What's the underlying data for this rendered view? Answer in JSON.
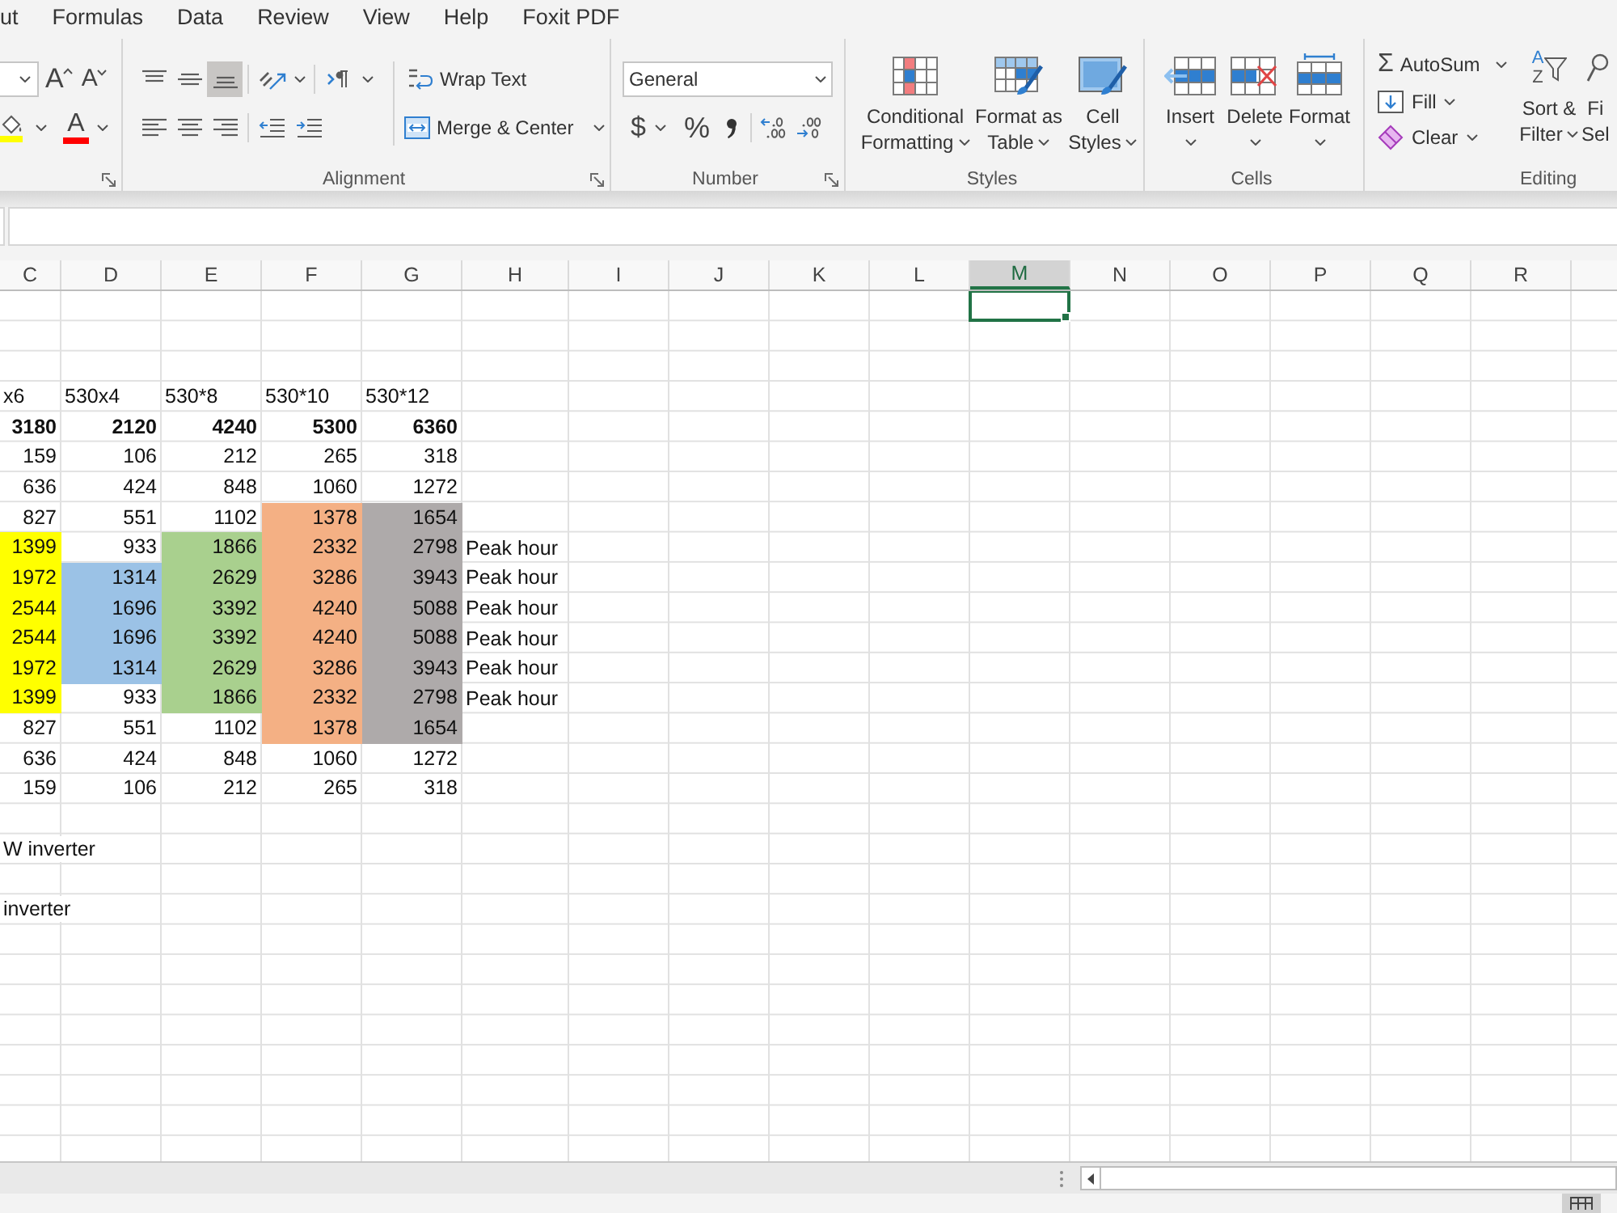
{
  "menu_tabs": [
    {
      "label": "ut",
      "selected": false
    },
    {
      "label": "Formulas",
      "selected": false
    },
    {
      "label": "Data",
      "selected": false
    },
    {
      "label": "Review",
      "selected": false
    },
    {
      "label": "View",
      "selected": false
    },
    {
      "label": "Help",
      "selected": false
    },
    {
      "label": "Foxit PDF",
      "selected": false
    }
  ],
  "ribbon": {
    "font": {
      "grow_glyph": "A",
      "shrink_glyph": "A",
      "font_color_glyph": "A"
    },
    "alignment": {
      "label": "Alignment",
      "vertical": [
        {
          "kind": "top",
          "selected": false
        },
        {
          "kind": "middle",
          "selected": false
        },
        {
          "kind": "bottom",
          "selected": true
        }
      ],
      "horizontal": [
        {
          "kind": "left",
          "selected": false
        },
        {
          "kind": "center",
          "selected": false
        },
        {
          "kind": "right",
          "selected": false
        }
      ],
      "wrap_text": "Wrap Text",
      "merge": "Merge & Center"
    },
    "number": {
      "label": "Number",
      "format": "General",
      "currency": "$",
      "percent": "%"
    },
    "styles": {
      "label": "Styles",
      "buttons": [
        {
          "kind": "conditional",
          "lines": [
            "Conditional",
            "Formatting"
          ]
        },
        {
          "kind": "table",
          "lines": [
            "Format as",
            "Table"
          ]
        },
        {
          "kind": "cell",
          "lines": [
            "Cell",
            "Styles"
          ]
        }
      ]
    },
    "cells": {
      "label": "Cells",
      "buttons": [
        {
          "kind": "insert",
          "label": "Insert"
        },
        {
          "kind": "delete",
          "label": "Delete"
        },
        {
          "kind": "format",
          "label": "Format"
        }
      ]
    },
    "editing": {
      "label": "Editing",
      "sum_glyph": "Σ",
      "autosum": "AutoSum",
      "fill": "Fill",
      "clear": "Clear",
      "sort_glyphs": [
        "A",
        "Z"
      ],
      "sort_lines": [
        "Sort &",
        "Filter"
      ],
      "find_lines": [
        "Fi",
        "Sel"
      ]
    }
  },
  "sheet": {
    "columns": [
      {
        "label": "C",
        "selected": false
      },
      {
        "label": "D",
        "selected": false
      },
      {
        "label": "E",
        "selected": false
      },
      {
        "label": "F",
        "selected": false
      },
      {
        "label": "G",
        "selected": false
      },
      {
        "label": "H",
        "selected": false
      },
      {
        "label": "I",
        "selected": false
      },
      {
        "label": "J",
        "selected": false
      },
      {
        "label": "K",
        "selected": false
      },
      {
        "label": "L",
        "selected": false
      },
      {
        "label": "M",
        "selected": true
      },
      {
        "label": "N",
        "selected": false
      },
      {
        "label": "O",
        "selected": false
      },
      {
        "label": "P",
        "selected": false
      },
      {
        "label": "Q",
        "selected": false
      },
      {
        "label": "R",
        "selected": false
      }
    ],
    "rows": [
      {
        "selected": true
      },
      {
        "selected": false
      },
      {
        "selected": false
      },
      {
        "selected": false,
        "bold": false,
        "cells": [
          {
            "text": "x6",
            "kind": "text"
          },
          {
            "text": "530x4",
            "kind": "text"
          },
          {
            "text": "530*8",
            "kind": "text"
          },
          {
            "text": "530*10",
            "kind": "text"
          },
          {
            "text": "530*12",
            "kind": "text"
          }
        ]
      },
      {
        "selected": false,
        "bold": true,
        "cells": [
          {
            "text": "3180",
            "kind": "number"
          },
          {
            "text": "2120",
            "kind": "number"
          },
          {
            "text": "4240",
            "kind": "number"
          },
          {
            "text": "5300",
            "kind": "number"
          },
          {
            "text": "6360",
            "kind": "number"
          }
        ]
      },
      {
        "selected": false,
        "bold": false,
        "cells": [
          {
            "text": "159",
            "kind": "number"
          },
          {
            "text": "106",
            "kind": "number"
          },
          {
            "text": "212",
            "kind": "number"
          },
          {
            "text": "265",
            "kind": "number"
          },
          {
            "text": "318",
            "kind": "number"
          }
        ]
      },
      {
        "selected": false,
        "bold": false,
        "cells": [
          {
            "text": "636",
            "kind": "number"
          },
          {
            "text": "424",
            "kind": "number"
          },
          {
            "text": "848",
            "kind": "number"
          },
          {
            "text": "1060",
            "kind": "number"
          },
          {
            "text": "1272",
            "kind": "number"
          }
        ]
      },
      {
        "selected": false,
        "bold": false,
        "cells": [
          {
            "text": "827",
            "kind": "number"
          },
          {
            "text": "551",
            "kind": "number"
          },
          {
            "text": "1102",
            "kind": "number"
          },
          {
            "text": "1378",
            "kind": "number",
            "color": "#f4b084"
          },
          {
            "text": "1654",
            "kind": "number",
            "color": "#aeaaaa"
          }
        ]
      },
      {
        "selected": false,
        "bold": false,
        "cells": [
          {
            "text": "1399",
            "kind": "number",
            "color": "#ffff00"
          },
          {
            "text": "933",
            "kind": "number"
          },
          {
            "text": "1866",
            "kind": "number",
            "color": "#a9d08e"
          },
          {
            "text": "2332",
            "kind": "number",
            "color": "#f4b084"
          },
          {
            "text": "2798",
            "kind": "number",
            "color": "#aeaaaa"
          },
          {
            "text": "Peak hour",
            "kind": "text"
          }
        ]
      },
      {
        "selected": false,
        "bold": false,
        "cells": [
          {
            "text": "1972",
            "kind": "number",
            "color": "#ffff00"
          },
          {
            "text": "1314",
            "kind": "number",
            "color": "#9bc2e6"
          },
          {
            "text": "2629",
            "kind": "number",
            "color": "#a9d08e"
          },
          {
            "text": "3286",
            "kind": "number",
            "color": "#f4b084"
          },
          {
            "text": "3943",
            "kind": "number",
            "color": "#aeaaaa"
          },
          {
            "text": "Peak hour",
            "kind": "text"
          }
        ]
      },
      {
        "selected": false,
        "bold": false,
        "cells": [
          {
            "text": "2544",
            "kind": "number",
            "color": "#ffff00"
          },
          {
            "text": "1696",
            "kind": "number",
            "color": "#9bc2e6"
          },
          {
            "text": "3392",
            "kind": "number",
            "color": "#a9d08e"
          },
          {
            "text": "4240",
            "kind": "number",
            "color": "#f4b084"
          },
          {
            "text": "5088",
            "kind": "number",
            "color": "#aeaaaa"
          },
          {
            "text": "Peak hour",
            "kind": "text"
          }
        ]
      },
      {
        "selected": false,
        "bold": false,
        "cells": [
          {
            "text": "2544",
            "kind": "number",
            "color": "#ffff00"
          },
          {
            "text": "1696",
            "kind": "number",
            "color": "#9bc2e6"
          },
          {
            "text": "3392",
            "kind": "number",
            "color": "#a9d08e"
          },
          {
            "text": "4240",
            "kind": "number",
            "color": "#f4b084"
          },
          {
            "text": "5088",
            "kind": "number",
            "color": "#aeaaaa"
          },
          {
            "text": "Peak hour",
            "kind": "text"
          }
        ]
      },
      {
        "selected": false,
        "bold": false,
        "cells": [
          {
            "text": "1972",
            "kind": "number",
            "color": "#ffff00"
          },
          {
            "text": "1314",
            "kind": "number",
            "color": "#9bc2e6"
          },
          {
            "text": "2629",
            "kind": "number",
            "color": "#a9d08e"
          },
          {
            "text": "3286",
            "kind": "number",
            "color": "#f4b084"
          },
          {
            "text": "3943",
            "kind": "number",
            "color": "#aeaaaa"
          },
          {
            "text": "Peak hour",
            "kind": "text"
          }
        ]
      },
      {
        "selected": false,
        "bold": false,
        "cells": [
          {
            "text": "1399",
            "kind": "number",
            "color": "#ffff00"
          },
          {
            "text": "933",
            "kind": "number"
          },
          {
            "text": "1866",
            "kind": "number",
            "color": "#a9d08e"
          },
          {
            "text": "2332",
            "kind": "number",
            "color": "#f4b084"
          },
          {
            "text": "2798",
            "kind": "number",
            "color": "#aeaaaa"
          },
          {
            "text": "Peak hour",
            "kind": "text"
          }
        ]
      },
      {
        "selected": false,
        "bold": false,
        "cells": [
          {
            "text": "827",
            "kind": "number"
          },
          {
            "text": "551",
            "kind": "number"
          },
          {
            "text": "1102",
            "kind": "number"
          },
          {
            "text": "1378",
            "kind": "number",
            "color": "#f4b084"
          },
          {
            "text": "1654",
            "kind": "number",
            "color": "#aeaaaa"
          }
        ]
      },
      {
        "selected": false,
        "bold": false,
        "cells": [
          {
            "text": "636",
            "kind": "number"
          },
          {
            "text": "424",
            "kind": "number"
          },
          {
            "text": "848",
            "kind": "number"
          },
          {
            "text": "1060",
            "kind": "number"
          },
          {
            "text": "1272",
            "kind": "number"
          }
        ]
      },
      {
        "selected": false,
        "bold": false,
        "cells": [
          {
            "text": "159",
            "kind": "number"
          },
          {
            "text": "106",
            "kind": "number"
          },
          {
            "text": "212",
            "kind": "number"
          },
          {
            "text": "265",
            "kind": "number"
          },
          {
            "text": "318",
            "kind": "number"
          }
        ]
      },
      {
        "selected": false
      },
      {
        "selected": false,
        "bold": false,
        "cells": [
          {
            "text": "W inverter",
            "kind": "text"
          }
        ]
      },
      {
        "selected": false
      },
      {
        "selected": false,
        "bold": false,
        "cells": [
          {
            "text": "inverter",
            "kind": "text"
          }
        ]
      }
    ]
  }
}
